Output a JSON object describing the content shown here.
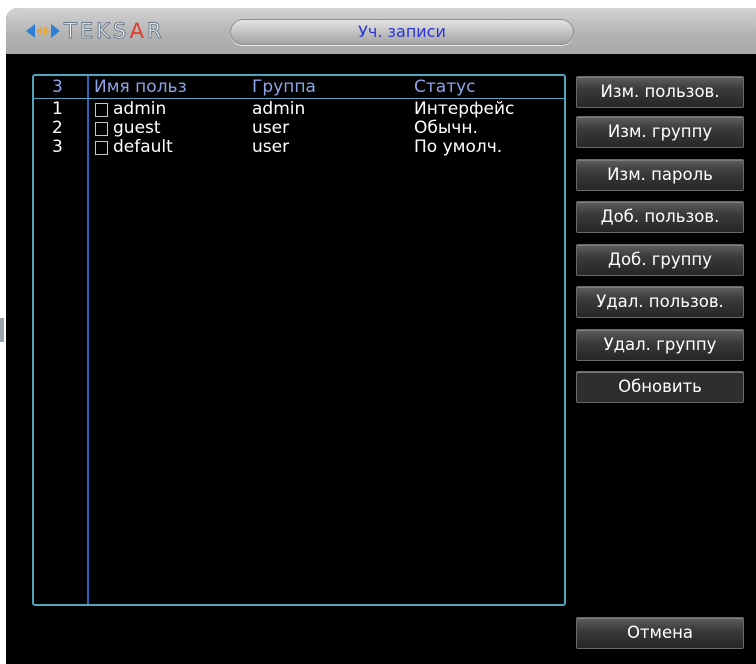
{
  "brand": "TEKSAR",
  "window": {
    "title": "Уч. записи"
  },
  "table": {
    "columns": [
      "3",
      "Имя польз",
      "Группа",
      "Статус"
    ],
    "rows": [
      {
        "num": "1",
        "name": "admin",
        "group": "admin",
        "status": "Интерфейс"
      },
      {
        "num": "2",
        "name": "guest",
        "group": "user",
        "status": "Обычн."
      },
      {
        "num": "3",
        "name": "default",
        "group": "user",
        "status": "По умолч."
      }
    ]
  },
  "buttons": {
    "modify_user": "Изм. пользов.",
    "modify_group": "Изм. группу",
    "modify_password": "Изм. пароль",
    "add_user": "Доб. пользов.",
    "add_group": "Доб. группу",
    "delete_user": "Удал. пользов.",
    "delete_group": "Удал. группу",
    "refresh": "Обновить",
    "cancel": "Отмена"
  },
  "colors": {
    "background": "#000000",
    "panel_border": "#4fa6be",
    "header_text": "#8ea4e6",
    "title_text": "#2a35d0",
    "logo_accent": "#e23c2a"
  },
  "icons": {
    "logo": "teksar-logo-arrows-icon",
    "checkbox": "checkbox-icon"
  }
}
